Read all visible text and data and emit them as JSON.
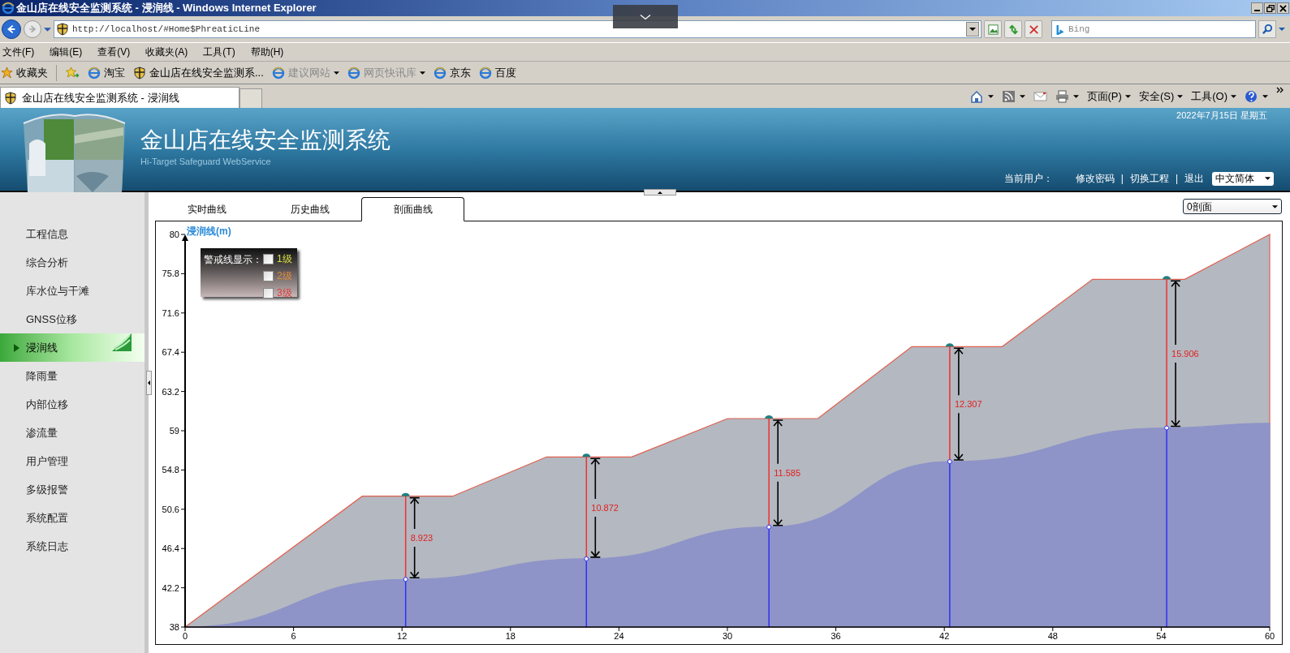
{
  "window": {
    "title": "金山店在线安全监测系统 - 浸润线 - Windows Internet Explorer"
  },
  "address_bar": {
    "url": "http://localhost/#Home$PhreaticLine"
  },
  "search_box": {
    "placeholder": "Bing"
  },
  "menu_bar": [
    "文件(F)",
    "编辑(E)",
    "查看(V)",
    "收藏夹(A)",
    "工具(T)",
    "帮助(H)"
  ],
  "favorites_bar": [
    {
      "label": "收藏夹",
      "kind": "star"
    },
    {
      "label": "淘宝",
      "kind": "ie"
    },
    {
      "label": "金山店在线安全监测系...",
      "kind": "shield"
    },
    {
      "label": "建议网站",
      "kind": "iedrop",
      "disabled": true
    },
    {
      "label": "网页快讯库",
      "kind": "iedrop",
      "disabled": true
    },
    {
      "label": "京东",
      "kind": "ie"
    },
    {
      "label": "百度",
      "kind": "ie"
    }
  ],
  "browser_tab": {
    "title": "金山店在线安全监测系统 - 浸润线"
  },
  "command_bar": [
    "页面(P)",
    "安全(S)",
    "工具(O)"
  ],
  "header": {
    "title": "金山店在线安全监测系统",
    "subtitle": "Hi-Target Safeguard WebService",
    "date": "2022年7月15日 星期五",
    "user_label": "当前用户：",
    "links": [
      "修改密码",
      "切换工程",
      "退出"
    ],
    "link_separator": "|",
    "language": "中文简体"
  },
  "sidebar": {
    "items": [
      {
        "label": "工程信息",
        "selected": false
      },
      {
        "label": "综合分析",
        "selected": false
      },
      {
        "label": "库水位与干滩",
        "selected": false
      },
      {
        "label": "GNSS位移",
        "selected": false
      },
      {
        "label": "浸润线",
        "selected": true
      },
      {
        "label": "降雨量",
        "selected": false
      },
      {
        "label": "内部位移",
        "selected": false
      },
      {
        "label": "渗流量",
        "selected": false
      },
      {
        "label": "用户管理",
        "selected": false
      },
      {
        "label": "多级报警",
        "selected": false
      },
      {
        "label": "系统配置",
        "selected": false
      },
      {
        "label": "系统日志",
        "selected": false
      }
    ]
  },
  "tabs": [
    {
      "label": "实时曲线",
      "selected": false
    },
    {
      "label": "历史曲线",
      "selected": false
    },
    {
      "label": "剖面曲线",
      "selected": true
    }
  ],
  "section_select": {
    "value": "0剖面"
  },
  "warning_legend": {
    "label": "警戒线显示：",
    "levels": [
      {
        "label": "1级",
        "checked": false,
        "color": "#d8e040"
      },
      {
        "label": "2级",
        "checked": false,
        "color": "#e08a3a"
      },
      {
        "label": "3级",
        "checked": false,
        "color": "#e03a3a"
      }
    ]
  },
  "chart_data": {
    "type": "area",
    "ylabel": "浸润线(m)",
    "x": [
      0,
      9.8,
      12.2,
      14.8,
      20,
      22.2,
      24.7,
      30,
      32.3,
      35,
      40.2,
      42.3,
      45.2,
      50.2,
      54.3,
      55.3,
      60
    ],
    "series": [
      {
        "color": "#b4b8c0",
        "values": [
          38,
          52,
          52,
          52,
          56.2,
          56.2,
          56.2,
          60.3,
          60.3,
          60.3,
          68,
          68,
          68,
          75.2,
          75.2,
          75.2,
          80
        ]
      },
      {
        "color": "#8e94c8",
        "values": [
          38,
          null,
          43.1,
          null,
          null,
          45.3,
          null,
          null,
          48.7,
          null,
          null,
          55.7,
          null,
          null,
          59.3,
          null,
          59.8
        ]
      }
    ],
    "xlim": [
      0,
      60
    ],
    "ylim": [
      38,
      80
    ],
    "xticks": [
      0,
      6,
      12,
      18,
      24,
      30,
      36,
      42,
      48,
      54,
      60
    ],
    "yticks": [
      38,
      42.2,
      46.4,
      50.6,
      54.8,
      59,
      63.2,
      67.4,
      71.6,
      75.8,
      80
    ],
    "annotations": [
      "8.923",
      "10.872",
      "11.585",
      "12.307",
      "15.906"
    ]
  }
}
